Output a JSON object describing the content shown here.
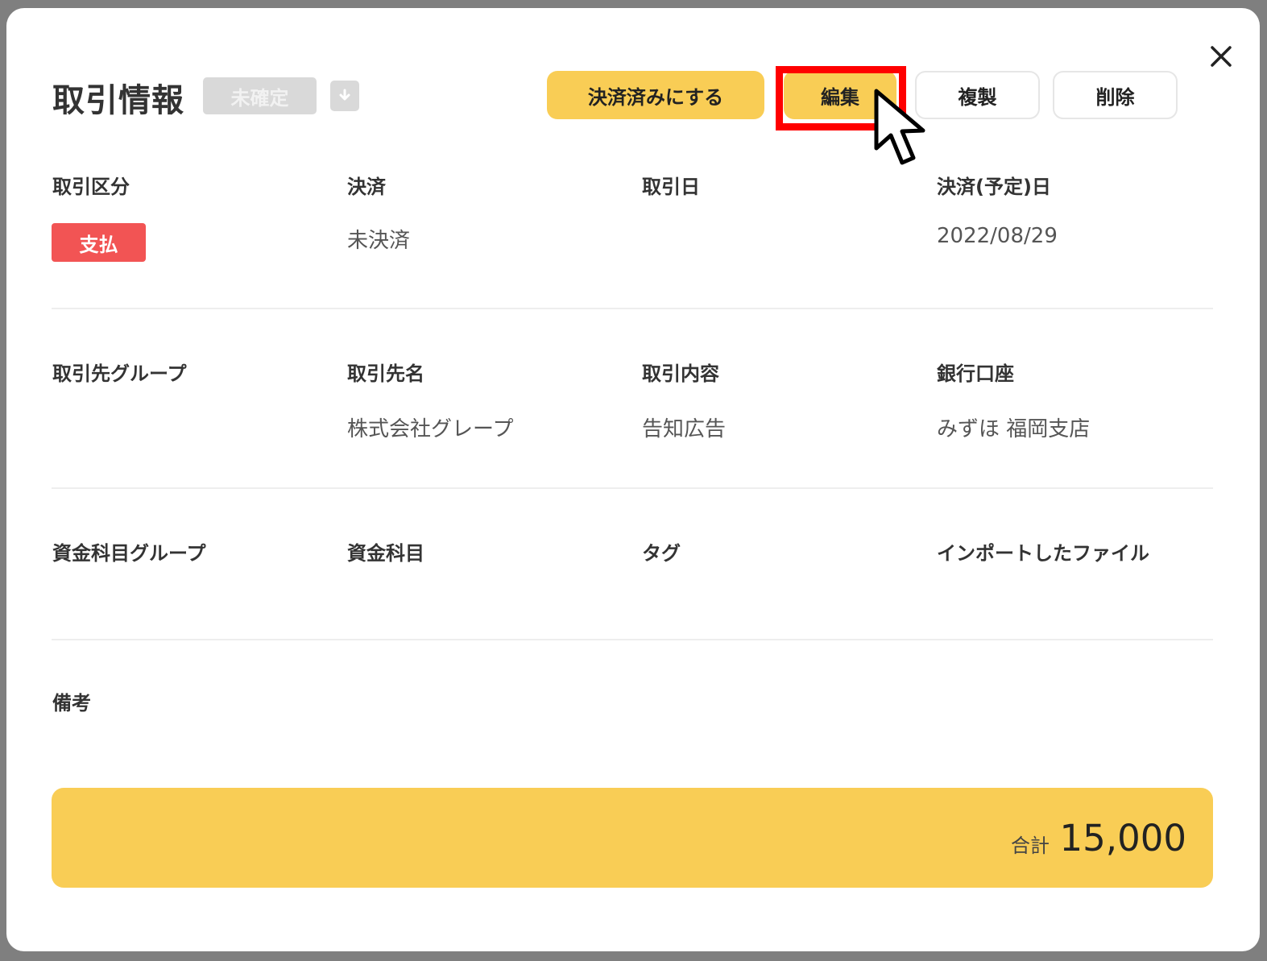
{
  "header": {
    "title": "取引情報",
    "status": "未確定",
    "buttons": {
      "settle": "決済済みにする",
      "edit": "編集",
      "duplicate": "複製",
      "delete": "削除"
    }
  },
  "row1": {
    "category_label": "取引区分",
    "category_value": "支払",
    "settlement_label": "決済",
    "settlement_value": "未決済",
    "date_label": "取引日",
    "date_value": "",
    "due_label": "決済(予定)日",
    "due_value": "2022/08/29"
  },
  "row2": {
    "group_label": "取引先グループ",
    "group_value": "",
    "partner_label": "取引先名",
    "partner_value": "株式会社グレープ",
    "content_label": "取引内容",
    "content_value": "告知広告",
    "bank_label": "銀行口座",
    "bank_value": "みずほ 福岡支店"
  },
  "row3": {
    "fund_group_label": "資金科目グループ",
    "fund_label": "資金科目",
    "tag_label": "タグ",
    "file_label": "インポートしたファイル"
  },
  "notes": {
    "label": "備考"
  },
  "total": {
    "label": "合計",
    "value": "15,000"
  },
  "colors": {
    "accent": "#f9cd55",
    "payment": "#f25454",
    "highlight": "#ff0000"
  },
  "icons": {
    "close": "close-icon",
    "download": "download-icon",
    "cursor": "mouse-pointer-icon"
  }
}
